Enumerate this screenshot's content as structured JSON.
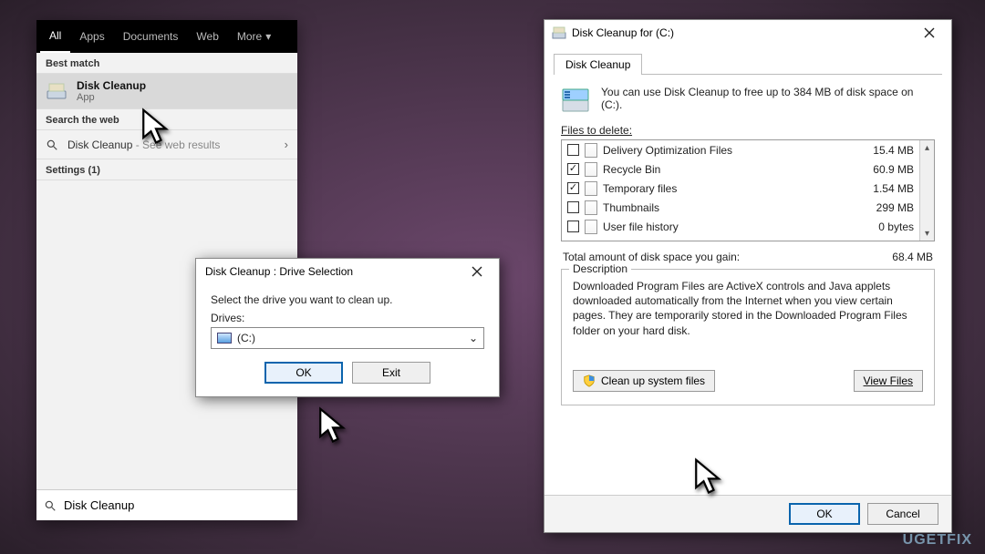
{
  "search": {
    "tabs": [
      "All",
      "Apps",
      "Documents",
      "Web",
      "More"
    ],
    "best_match_header": "Best match",
    "result": {
      "title": "Disk Cleanup",
      "subtitle": "App"
    },
    "web_header": "Search the web",
    "web_line_prefix": "Disk Cleanup",
    "web_line_suffix": " - See web results",
    "settings_header": "Settings (1)",
    "input_value": "Disk Cleanup"
  },
  "drive_dialog": {
    "title": "Disk Cleanup : Drive Selection",
    "prompt": "Select the drive you want to clean up.",
    "drives_label": "Drives:",
    "selected": " (C:)",
    "ok": "OK",
    "exit": "Exit"
  },
  "cleanup": {
    "title": "Disk Cleanup for  (C:)",
    "tab": "Disk Cleanup",
    "intro": "You can use Disk Cleanup to free up to 384 MB of disk space on  (C:).",
    "files_label": "Files to delete:",
    "files": [
      {
        "name": "Delivery Optimization Files",
        "size": "15.4 MB",
        "checked": false
      },
      {
        "name": "Recycle Bin",
        "size": "60.9 MB",
        "checked": true
      },
      {
        "name": "Temporary files",
        "size": "1.54 MB",
        "checked": true
      },
      {
        "name": "Thumbnails",
        "size": "299 MB",
        "checked": false
      },
      {
        "name": "User file history",
        "size": "0 bytes",
        "checked": false
      }
    ],
    "total_label": "Total amount of disk space you gain:",
    "total_value": "68.4 MB",
    "desc_header": "Description",
    "desc_text": "Downloaded Program Files are ActiveX controls and Java applets downloaded automatically from the Internet when you view certain pages. They are temporarily stored in the Downloaded Program Files folder on your hard disk.",
    "clean_system": "Clean up system files",
    "view_files": "View Files",
    "ok": "OK",
    "cancel": "Cancel"
  },
  "watermark": "UGETFIX"
}
